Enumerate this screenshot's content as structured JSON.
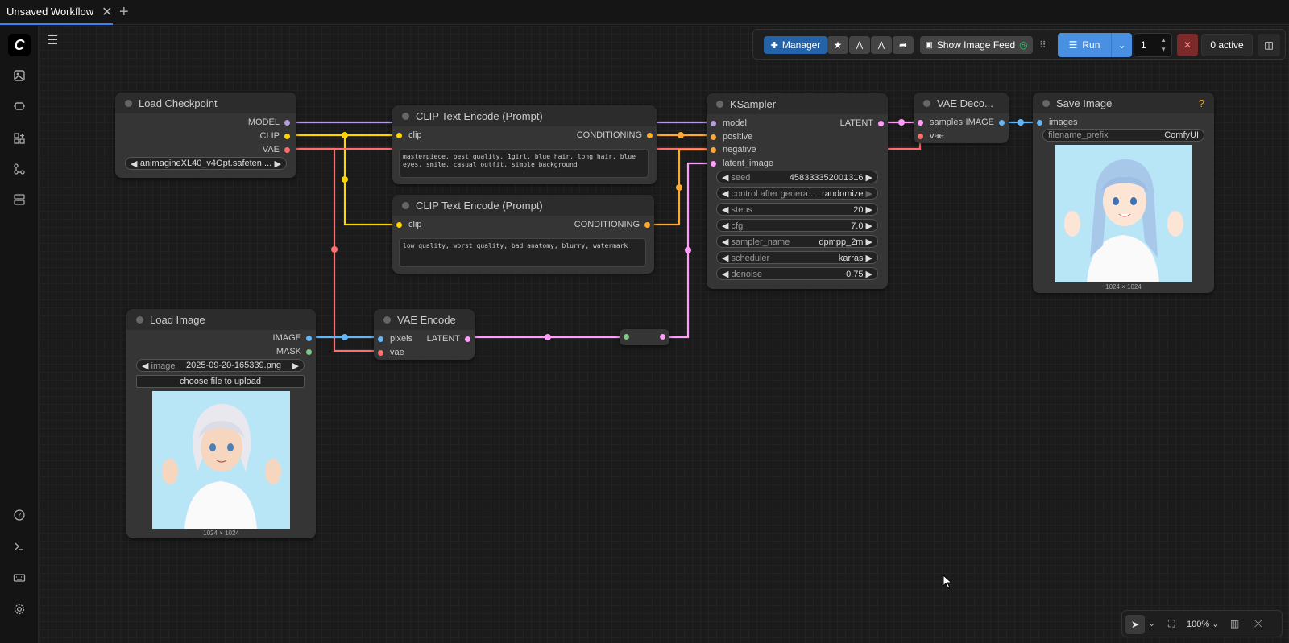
{
  "tabs": [
    {
      "label": "Unsaved Workflow"
    }
  ],
  "toolbar": {
    "manager_label": "Manager",
    "show_image_feed_label": "Show Image Feed",
    "run_label": "Run",
    "batch_count": "1",
    "active_label": "0 active"
  },
  "nodes": {
    "load_checkpoint": {
      "title": "Load Checkpoint",
      "outputs": [
        "MODEL",
        "CLIP",
        "VAE"
      ],
      "ckpt_name": "animagineXL40_v4Opt.safeten ..."
    },
    "clip_pos": {
      "title": "CLIP Text Encode (Prompt)",
      "input": "clip",
      "output": "CONDITIONING",
      "text": "masterpiece, best quality, 1girl, blue hair, long hair, blue eyes, smile, casual outfit, simple background"
    },
    "clip_neg": {
      "title": "CLIP Text Encode (Prompt)",
      "input": "clip",
      "output": "CONDITIONING",
      "text": "low quality, worst quality, bad anatomy, blurry, watermark"
    },
    "ksampler": {
      "title": "KSampler",
      "inputs": [
        "model",
        "positive",
        "negative",
        "latent_image"
      ],
      "output": "LATENT",
      "widgets": [
        {
          "label": "seed",
          "value": "458333352001316"
        },
        {
          "label": "control after genera...",
          "value": "randomize"
        },
        {
          "label": "steps",
          "value": "20"
        },
        {
          "label": "cfg",
          "value": "7.0"
        },
        {
          "label": "sampler_name",
          "value": "dpmpp_2m"
        },
        {
          "label": "scheduler",
          "value": "karras"
        },
        {
          "label": "denoise",
          "value": "0.75"
        }
      ]
    },
    "vae_decode": {
      "title": "VAE Deco...",
      "inputs": [
        "samples",
        "vae"
      ],
      "output": "IMAGE"
    },
    "save_image": {
      "title": "Save Image",
      "input": "images",
      "help": "?",
      "filename_prefix_label": "filename_prefix",
      "filename_prefix": "ComfyUI",
      "caption": "1024 × 1024"
    },
    "load_image": {
      "title": "Load Image",
      "outputs": [
        "IMAGE",
        "MASK"
      ],
      "image_label": "image",
      "image_value": "2025-09-20-165339.png",
      "upload_label": "choose file to upload",
      "caption": "1024 × 1024"
    },
    "vae_encode": {
      "title": "VAE Encode",
      "inputs": [
        "pixels",
        "vae"
      ],
      "output": "LATENT"
    }
  },
  "bottom": {
    "zoom": "100%"
  },
  "colors": {
    "model": "#b39ddb",
    "clip": "#ffd500",
    "vae": "#ff6e6e",
    "conditioning": "#ffa931",
    "latent": "#ff9cf9",
    "image": "#64b5f6",
    "mask": "#81c784",
    "accent": "#3b82f6"
  }
}
